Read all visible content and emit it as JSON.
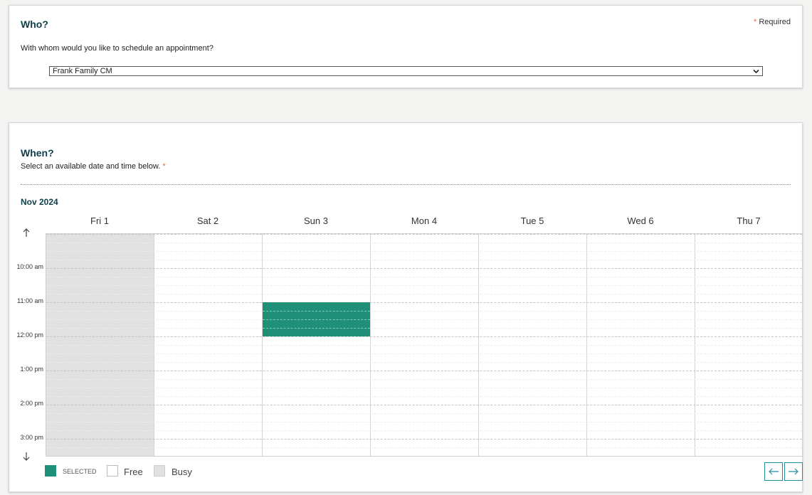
{
  "who": {
    "title": "Who?",
    "required_star": "*",
    "required_label": "Required",
    "question": "With whom would you like to schedule an appointment?",
    "selected_option": "Frank Family CM"
  },
  "when": {
    "title": "When?",
    "subtitle": "Select an available date and time below.",
    "required_star": "*",
    "month": "Nov 2024",
    "days": [
      "Fri 1",
      "Sat 2",
      "Sun 3",
      "Mon 4",
      "Tue 5",
      "Wed 6",
      "Thu 7"
    ],
    "busy_days": [
      "Fri 1"
    ],
    "times": [
      "10:00 am",
      "11:00 am",
      "12:00 pm",
      "1:00 pm",
      "2:00 pm",
      "3:00 pm"
    ],
    "selected_slot": {
      "day": "Sun 3",
      "start": "11:00 am",
      "end": "12:00 pm"
    }
  },
  "legend": {
    "selected_label": "SELECTED",
    "free_label": "Free",
    "busy_label": "Busy"
  },
  "colors": {
    "accent": "#1f8f78",
    "heading": "#0f3d4c",
    "busy": "#e1e1e1",
    "required_star": "#e06c3c",
    "nav_border": "#1f8fa0"
  },
  "icons": {
    "scroll_up": "arrow-up-icon",
    "scroll_down": "arrow-down-icon",
    "prev": "arrow-left-icon",
    "next": "arrow-right-icon",
    "dropdown": "chevron-down-icon"
  }
}
